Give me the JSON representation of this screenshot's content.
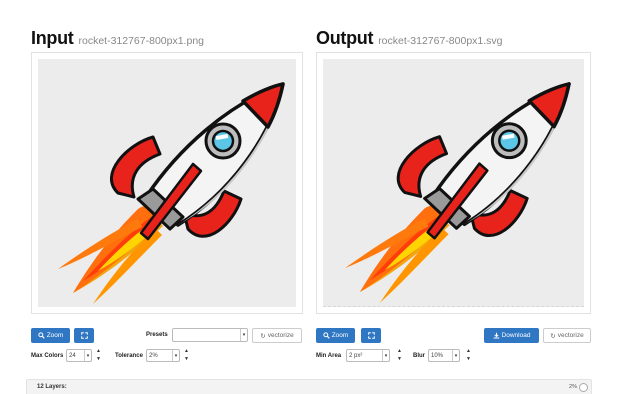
{
  "input_panel": {
    "heading": "Input",
    "filename": "rocket-312767-800px1.png"
  },
  "output_panel": {
    "heading": "Output",
    "filename": "rocket-312767-800px1.svg"
  },
  "input_controls": {
    "zoom_label": "Zoom",
    "presets_label": "Presets",
    "presets_value": "",
    "vectorize_label": "vectorize",
    "max_colors_label": "Max Colors",
    "max_colors_value": "24",
    "tolerance_label": "Tolerance",
    "tolerance_value": "2%"
  },
  "output_controls": {
    "zoom_label": "Zoom",
    "download_label": "Download",
    "vectorize_label": "vectorize",
    "min_area_label": "Min Area",
    "min_area_value": "2 px²",
    "blur_label": "Blur",
    "blur_value": "10%"
  },
  "layers": {
    "label": "12 Layers:",
    "percent": "2%"
  },
  "icons": {
    "zoom": "search-icon",
    "fullscreen": "expand-icon",
    "vectorize": "refresh-icon",
    "download": "download-icon",
    "stepper_up": "chevron-up-icon",
    "stepper_down": "chevron-down-icon"
  },
  "colors": {
    "accent": "#2f77c3",
    "rocket_red": "#e8231c",
    "flame_orange": "#f57f17",
    "flame_yellow": "#ffd600"
  }
}
